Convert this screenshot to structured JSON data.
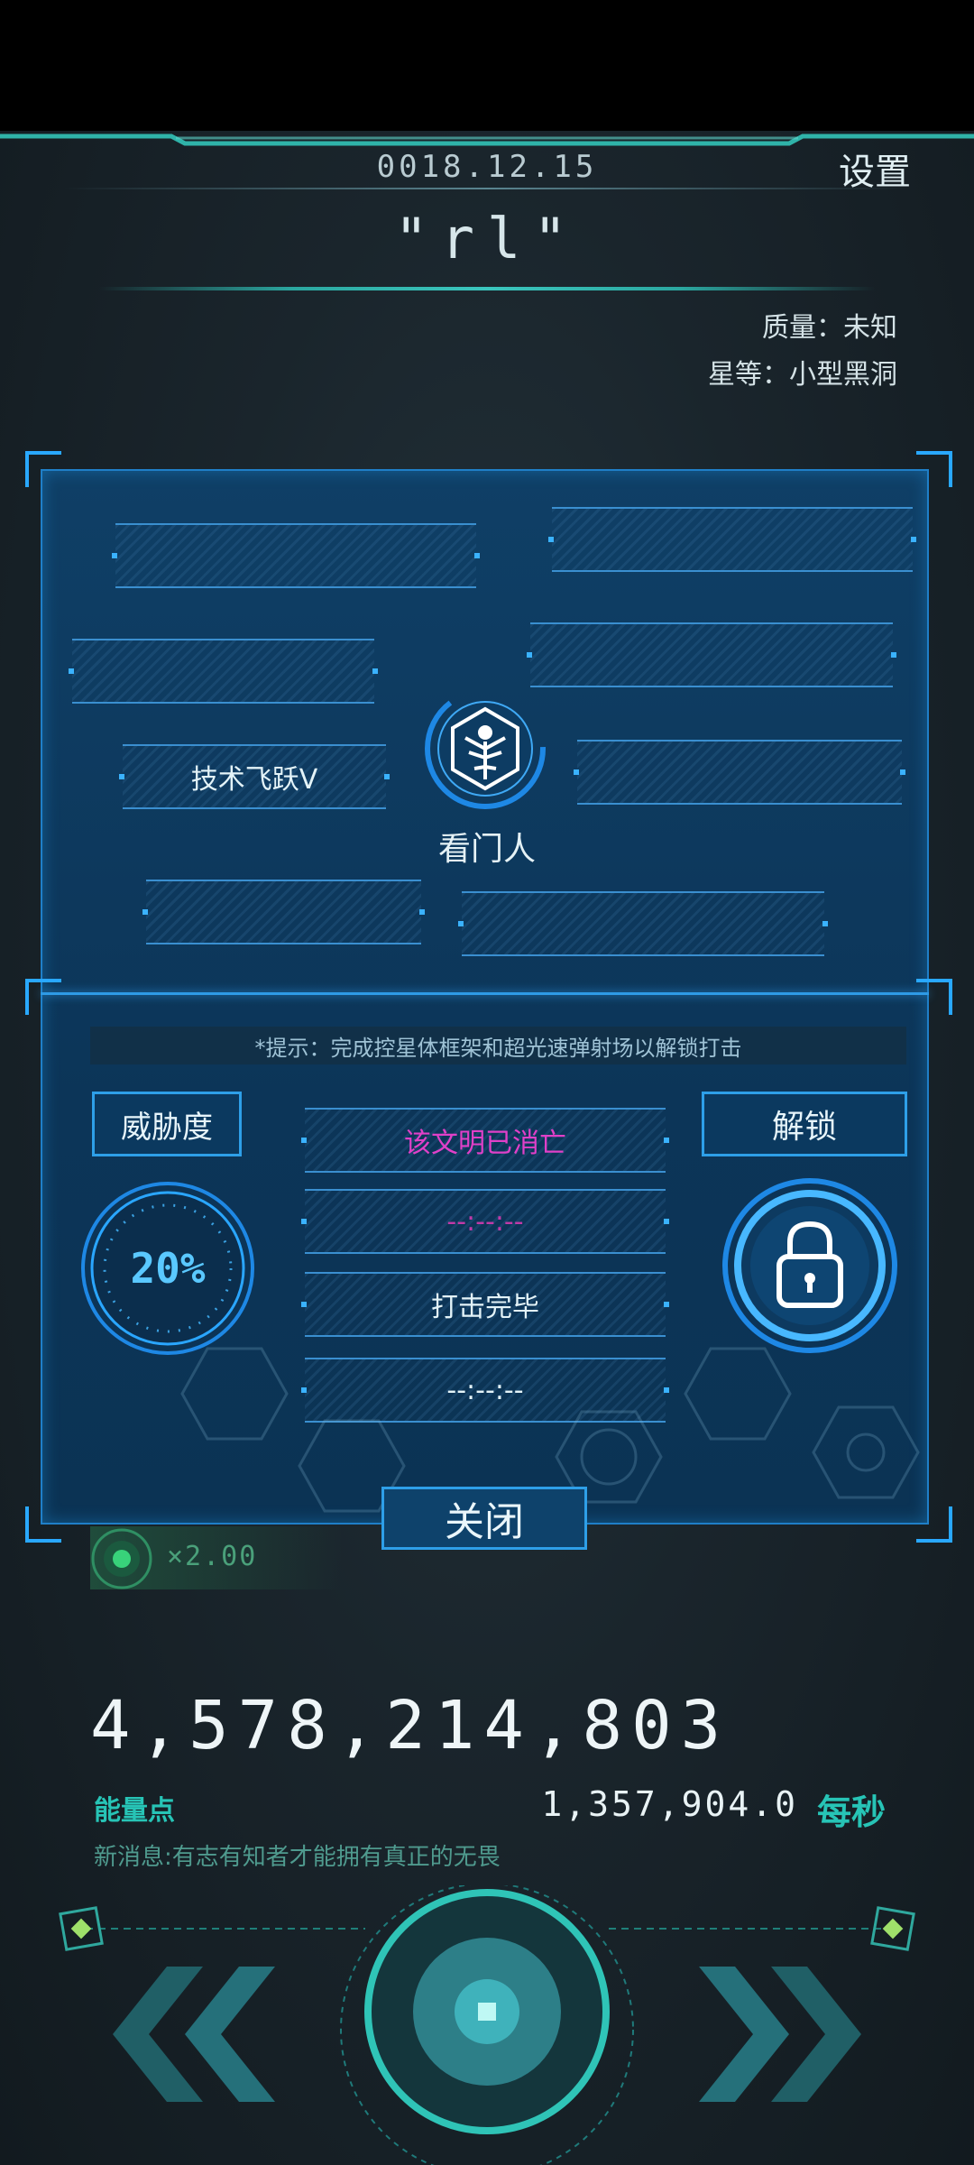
{
  "header": {
    "date": "0018.12.15",
    "settings_label": "设置",
    "star_name": "\"rl\"",
    "quality": "质量：未知",
    "star_class": "星等：小型黑洞"
  },
  "panel": {
    "tech_slot": "技术飞跃V",
    "emblem_label": "看门人",
    "hint": "*提示：完成控星体框架和超光速弹射场以解锁打击",
    "threat_label": "威胁度",
    "threat_value": "20%",
    "unlock_label": "解锁",
    "status": [
      "该文明已消亡",
      "--:--:--",
      "打击完毕",
      "--:--:--"
    ],
    "close_label": "关闭"
  },
  "multiplier": "×2.00",
  "resources": {
    "energy_value": "4,578,214,803",
    "energy_label": "能量点",
    "rate_value": "1,357,904.0",
    "rate_unit": "每秒",
    "news": "新消息:有志有知者才能拥有真正的无畏"
  },
  "colors": {
    "accent_blue": "#2e9fe8",
    "accent_teal": "#27c4b6",
    "status_dead": "#e040c8"
  },
  "icons": [
    "gatekeeper-emblem-icon",
    "lock-icon",
    "radar-icon",
    "prev-arrows-icon",
    "next-arrows-icon",
    "center-core-icon"
  ]
}
